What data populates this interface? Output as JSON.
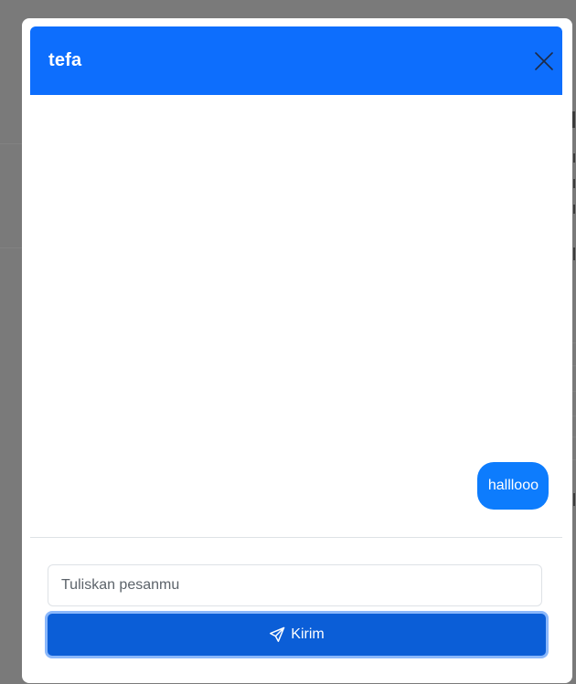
{
  "modal": {
    "title": "tefa",
    "close_icon": "close-icon"
  },
  "chat": {
    "messages": [
      {
        "text": "halllooo",
        "sender": "self"
      }
    ]
  },
  "composer": {
    "placeholder": "Tuliskan pesanmu",
    "value": "",
    "send_label": "Kirim",
    "send_icon": "paper-plane-icon"
  },
  "colors": {
    "header": "#0d6efd",
    "bubble": "#0d7cfd",
    "button": "#0b5ed7",
    "overlay": "#7a7a7a"
  }
}
